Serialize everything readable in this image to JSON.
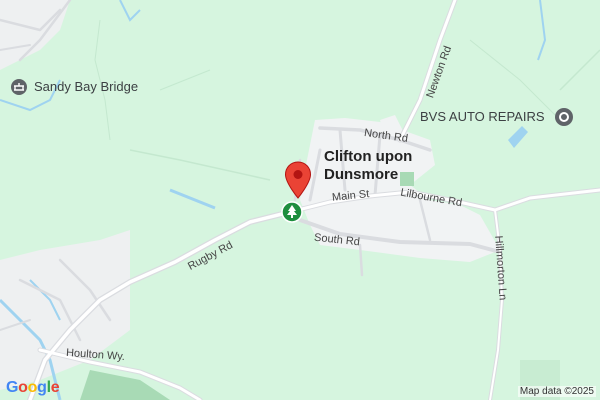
{
  "map": {
    "town": {
      "line1": "Clifton upon",
      "line2": "Dunsmore"
    },
    "pois": {
      "sandy_bay_bridge": "Sandy Bay Bridge",
      "bvs_auto_repairs": "BVS AUTO REPAIRS"
    },
    "roads": {
      "north_rd": "North Rd",
      "main_st": "Main St",
      "lilbourne_rd": "Lilbourne Rd",
      "newton_rd": "Newton Rd",
      "south_rd": "South Rd",
      "rugby_rd": "Rugby Rd",
      "hillmorton_ln": "Hillmorton Ln",
      "houlton_wy": "Houlton Wy."
    },
    "attribution": "Map data ©2025",
    "logo": {
      "g1": "G",
      "o1": "o",
      "o2": "o",
      "g2": "g",
      "l": "l",
      "e": "e"
    },
    "colors": {
      "land": "#d6f5df",
      "urban": "#f1f3f4",
      "road": "#dadce0",
      "water": "#9fd3f0",
      "marker": "#ea4335"
    },
    "icons": [
      "landmark-icon",
      "location-pin-icon",
      "park-tree-icon",
      "map-marker-icon"
    ]
  }
}
